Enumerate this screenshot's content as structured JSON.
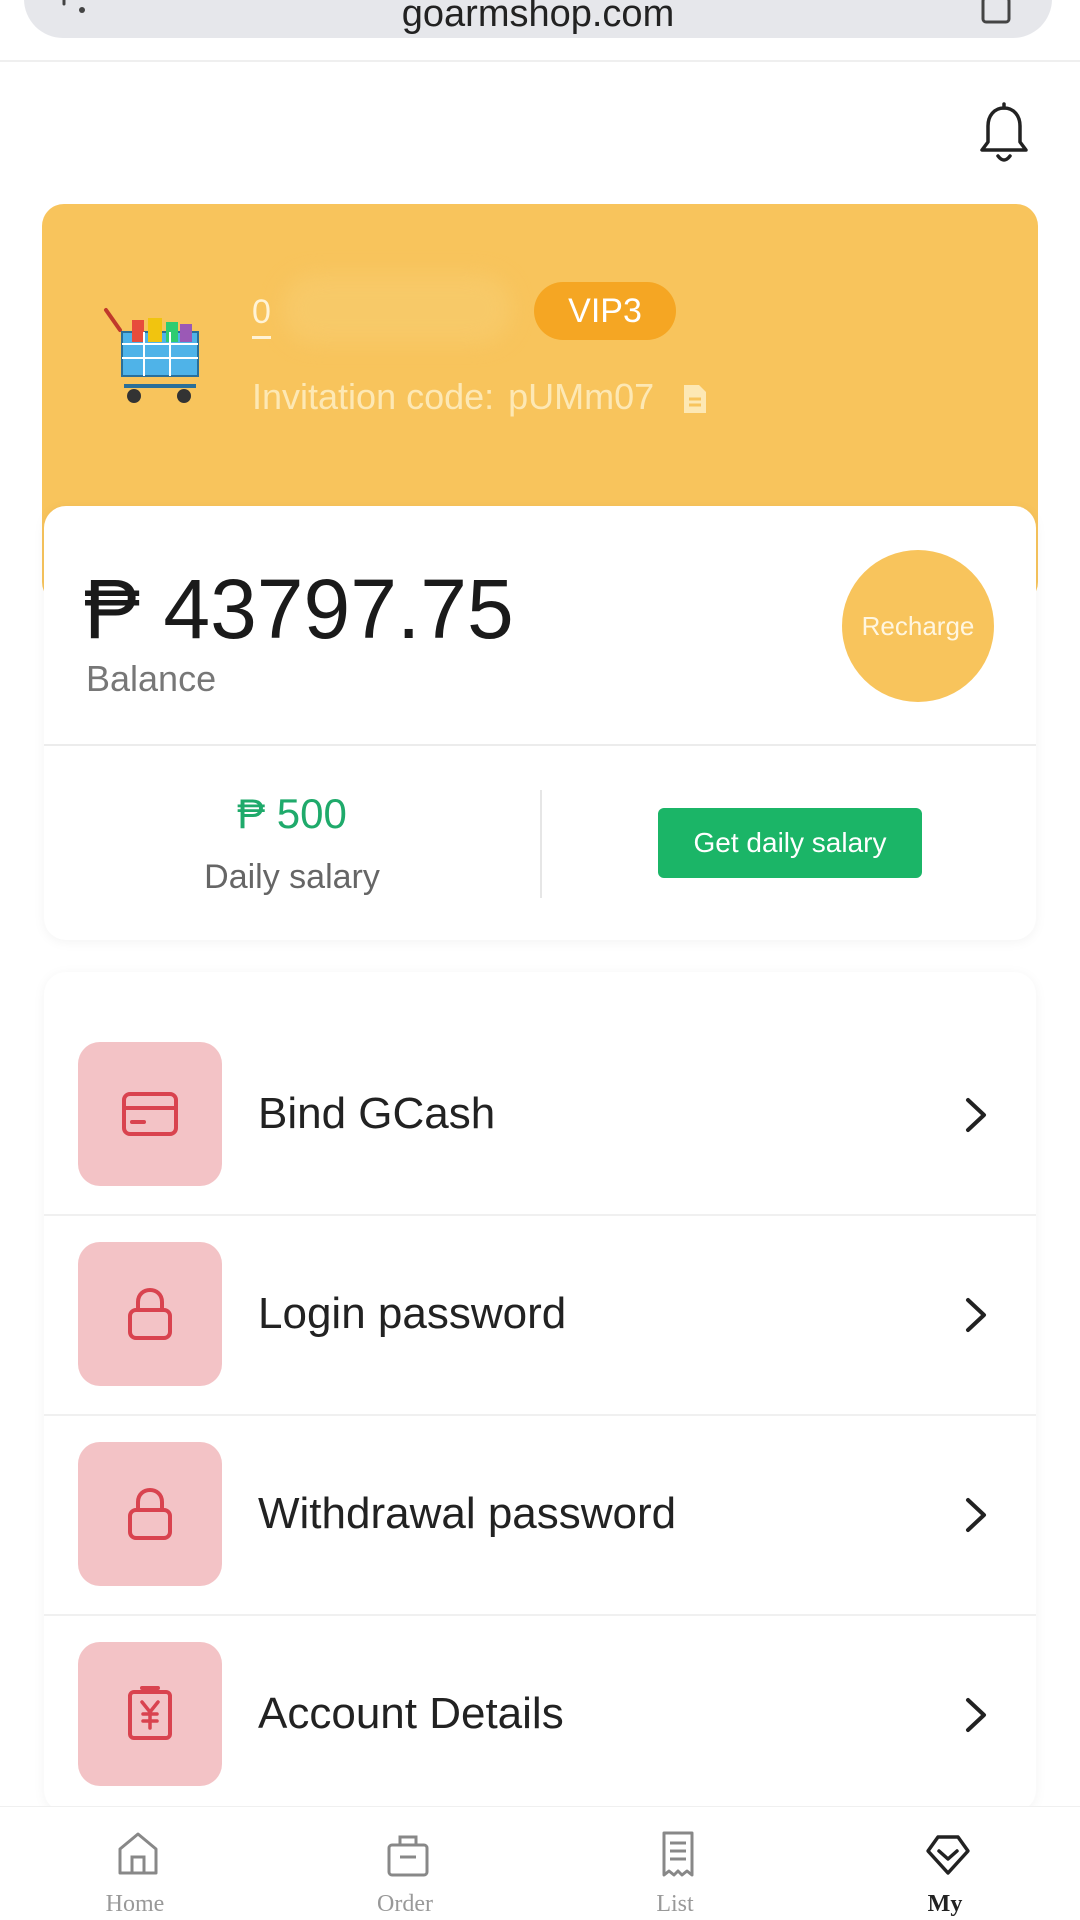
{
  "browser": {
    "url": "goarmshop.com"
  },
  "profile": {
    "username": "0",
    "vip_level": "VIP3",
    "invitation_label": "Invitation code:",
    "invitation_code": "pUMm07"
  },
  "balance": {
    "amount": "₱ 43797.75",
    "label": "Balance",
    "recharge_label": "Recharge"
  },
  "salary": {
    "amount": "₱ 500",
    "label": "Daily salary",
    "button_label": "Get daily salary"
  },
  "menu": {
    "items": [
      {
        "label": "Bind GCash",
        "icon": "card-icon"
      },
      {
        "label": "Login password",
        "icon": "lock-icon"
      },
      {
        "label": "Withdrawal password",
        "icon": "lock-icon"
      },
      {
        "label": "Account Details",
        "icon": "yuan-receipt-icon"
      }
    ]
  },
  "nav": {
    "items": [
      {
        "label": "Home",
        "icon": "home-icon"
      },
      {
        "label": "Order",
        "icon": "order-bag-icon"
      },
      {
        "label": "List",
        "icon": "list-icon"
      },
      {
        "label": "My",
        "icon": "my-diamond-icon",
        "active": true
      }
    ]
  },
  "colors": {
    "brand_yellow": "#f8c45c",
    "vip_orange": "#f5a623",
    "salary_green": "#1bb567",
    "icon_pink_bg": "#f3c3c6",
    "icon_red": "#d9434f"
  }
}
